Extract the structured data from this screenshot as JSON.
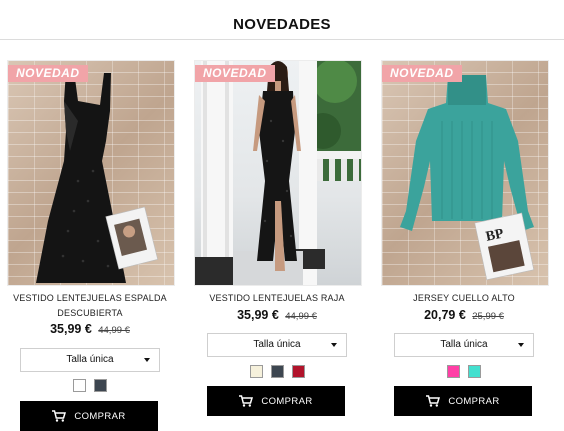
{
  "section": {
    "title": "NOVEDADES"
  },
  "products": [
    {
      "badge": "NOVEDAD",
      "name_line1": "VESTIDO LENTEJUELAS ESPALDA",
      "name_line2": "DESCUBIERTA",
      "price": "35,99 €",
      "old_price": "44,99 €",
      "size_label": "Talla única",
      "swatches": [
        "#ffffff",
        "#3d4650"
      ],
      "buy_label": "COMPRAR",
      "image_icon": "black-sequin-dress-image"
    },
    {
      "badge": "NOVEDAD",
      "name_line1": "VESTIDO LENTEJUELAS RAJA",
      "name_line2": "",
      "price": "35,99 €",
      "old_price": "44,99 €",
      "size_label": "Talla única",
      "swatches": [
        "#f6f1dc",
        "#3d4650",
        "#b1132b"
      ],
      "buy_label": "COMPRAR",
      "image_icon": "model-sequin-dress-image"
    },
    {
      "badge": "NOVEDAD",
      "name_line1": "JERSEY CUELLO ALTO",
      "name_line2": "",
      "price": "20,79 €",
      "old_price": "25,99 €",
      "size_label": "Talla única",
      "swatches": [
        "#ff3fa6",
        "#43e0cf"
      ],
      "buy_label": "COMPRAR",
      "image_icon": "turtleneck-sweater-image"
    }
  ],
  "colors": {
    "badge": "#f1a4a8",
    "button": "#000000"
  },
  "icons": {
    "cart": "cart-icon",
    "caret": "chevron-down-icon"
  }
}
